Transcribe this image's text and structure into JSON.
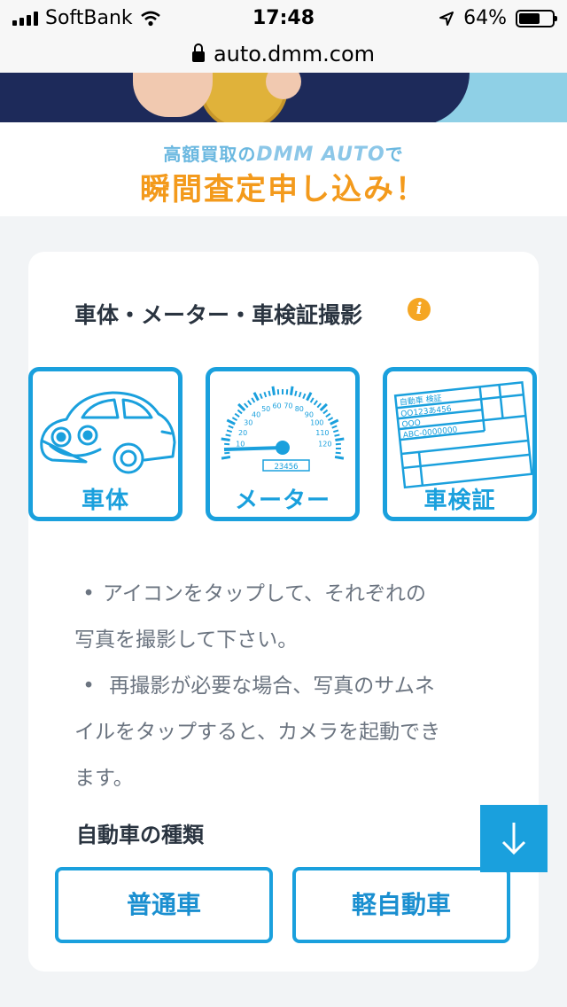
{
  "status_bar": {
    "carrier": "SoftBank",
    "time": "17:48",
    "battery_text": "64%",
    "battery_level": 0.64,
    "icons": [
      "signal-icon",
      "wifi-icon",
      "location-arrow-icon",
      "battery-icon"
    ]
  },
  "browser": {
    "url": "auto.dmm.com"
  },
  "banner": {
    "sub_prefix": "高額買取の",
    "logo_text": "DMM AUTO",
    "sub_suffix": "で",
    "main": "瞬間査定申し込み！"
  },
  "card": {
    "title": "車体・メーター・車検証撮影",
    "info_icon": "i",
    "photo_buttons": [
      {
        "label": "車体",
        "icon": "car-icon"
      },
      {
        "label": "メーター",
        "icon": "speedometer-icon"
      },
      {
        "label": "車検証",
        "icon": "inspection-certificate-icon"
      }
    ],
    "meter": {
      "ticks": [
        "10",
        "20",
        "30",
        "40",
        "50",
        "60",
        "70",
        "80",
        "90",
        "100",
        "110",
        "120"
      ],
      "odometer": "23456"
    },
    "certificate": {
      "header": "自動車 検証",
      "line1": "OO123あ456",
      "line2": "OOO",
      "line3": "ABC-0000000"
    },
    "notes": [
      {
        "bullet": "•",
        "line1": "アイコンをタップして、それぞれの",
        "line2": "写真を撮影して下さい。"
      },
      {
        "bullet": "•",
        "line1": " 再撮影が必要な場合、写真のサムネ",
        "line2": "イルをタップすると、カメラを起動でき",
        "line3": "ます。"
      }
    ],
    "car_type_title": "自動車の種類",
    "car_types": [
      "普通車",
      "軽自動車"
    ]
  },
  "colors": {
    "accent": "#1aa0dd",
    "banner_orange": "#f39a1c",
    "info_orange": "#f5a623",
    "background": "#f2f4f6"
  },
  "scroll_button": {
    "icon": "arrow-down-icon"
  }
}
